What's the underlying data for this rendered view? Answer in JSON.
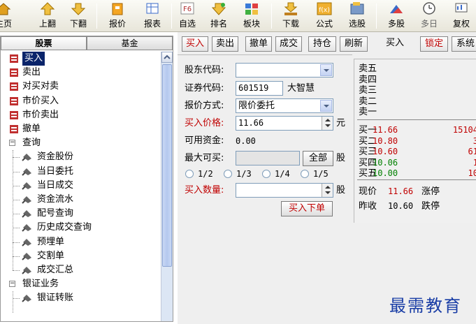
{
  "toolbar": {
    "items": [
      {
        "label": "主页",
        "icon": "home-icon"
      },
      {
        "label": "上翻",
        "icon": "arrow-up-icon"
      },
      {
        "label": "下翻",
        "icon": "arrow-down-icon"
      },
      {
        "label": "报价",
        "icon": "quote-icon"
      },
      {
        "label": "报表",
        "icon": "report-icon"
      },
      {
        "label": "自选",
        "icon": "f6-favorites-icon",
        "hotkey": "F6"
      },
      {
        "label": "排名",
        "icon": "ranking-icon"
      },
      {
        "label": "板块",
        "icon": "sector-icon"
      },
      {
        "label": "下载",
        "icon": "download-icon"
      },
      {
        "label": "公式",
        "icon": "formula-icon",
        "glyph": "f(x)"
      },
      {
        "label": "选股",
        "icon": "stock-picker-icon"
      },
      {
        "label": "多股",
        "icon": "multi-stock-icon"
      },
      {
        "label": "多日",
        "icon": "multi-day-icon"
      },
      {
        "label": "复权",
        "icon": "adjust-icon"
      }
    ]
  },
  "left_panel": {
    "tabs": [
      {
        "label": "股票",
        "active": true
      },
      {
        "label": "基金",
        "active": false
      }
    ],
    "tree": [
      {
        "label": "买入",
        "icon": "buy-icon",
        "selected": true
      },
      {
        "label": "卖出",
        "icon": "sell-icon"
      },
      {
        "label": "对买对卖",
        "icon": "pair-trade-icon"
      },
      {
        "label": "市价买入",
        "icon": "market-buy-icon"
      },
      {
        "label": "市价卖出",
        "icon": "market-sell-icon"
      },
      {
        "label": "撤单",
        "icon": "cancel-order-icon"
      },
      {
        "label": "查询",
        "expander": "−"
      },
      {
        "label": "资金股份",
        "icon": "query-item-icon"
      },
      {
        "label": "当日委托",
        "icon": "query-item-icon"
      },
      {
        "label": "当日成交",
        "icon": "query-item-icon"
      },
      {
        "label": "资金流水",
        "icon": "query-item-icon"
      },
      {
        "label": "配号查询",
        "icon": "query-item-icon"
      },
      {
        "label": "历史成交查询",
        "icon": "query-item-icon"
      },
      {
        "label": "预埋单",
        "icon": "query-item-icon"
      },
      {
        "label": "交割单",
        "icon": "query-item-icon"
      },
      {
        "label": "成交汇总",
        "icon": "query-item-icon"
      },
      {
        "label": "银证业务",
        "expander": "−"
      },
      {
        "label": "银证转账",
        "icon": "query-item-icon"
      }
    ]
  },
  "tabs": [
    {
      "label": "买入",
      "active": true
    },
    {
      "label": "卖出"
    },
    {
      "label": "撤单"
    },
    {
      "label": "成交"
    },
    {
      "label": "持仓"
    },
    {
      "label": "刷新"
    },
    {
      "label": "买入",
      "plain": true
    },
    {
      "label": "锁定",
      "red": true
    },
    {
      "label": "系统"
    }
  ],
  "form": {
    "holder_code_label": "股东代码:",
    "holder_code_value": "",
    "security_code_label": "证券代码:",
    "security_code_value": "601519",
    "security_name": "大智慧",
    "quote_method_label": "报价方式:",
    "quote_method_value": "限价委托",
    "buy_price_label": "买入价格:",
    "buy_price_value": "11.66",
    "price_unit": "元",
    "available_funds_label": "可用资金:",
    "available_funds_value": "0.00",
    "max_buy_label": "最大可买:",
    "max_buy_value": "",
    "all_button": "全部",
    "share_unit": "股",
    "ratios": [
      "1/2",
      "1/3",
      "1/4",
      "1/5"
    ],
    "buy_qty_label": "买入数量:",
    "buy_qty_value": "",
    "qty_unit": "股",
    "submit_button": "买入下单"
  },
  "quote": {
    "sell_levels": [
      {
        "label": "卖五",
        "price": "",
        "volume": ""
      },
      {
        "label": "卖四",
        "price": "",
        "volume": ""
      },
      {
        "label": "卖三",
        "price": "",
        "volume": ""
      },
      {
        "label": "卖二",
        "price": "",
        "volume": ""
      },
      {
        "label": "卖一",
        "price": "",
        "volume": ""
      }
    ],
    "buy_levels": [
      {
        "label": "买一",
        "price": "11.66",
        "volume": "15104",
        "color": "red"
      },
      {
        "label": "买二",
        "price": "10.80",
        "volume": "3",
        "color": "red"
      },
      {
        "label": "买三",
        "price": "10.60",
        "volume": "61",
        "color": "red"
      },
      {
        "label": "买四",
        "price": "10.06",
        "volume": "1",
        "color": "green"
      },
      {
        "label": "买五",
        "price": "10.00",
        "volume": "10",
        "color": "green"
      }
    ],
    "current_label": "现价",
    "current_value": "11.66",
    "limit_up_label": "涨停",
    "prev_close_label": "昨收",
    "prev_close_value": "10.60",
    "limit_down_label": "跌停"
  },
  "watermark": "最需教育",
  "colors": {
    "accent_red": "#c00000",
    "green": "#008000",
    "selection": "#0a246a",
    "watermark": "#1a3ea6"
  }
}
